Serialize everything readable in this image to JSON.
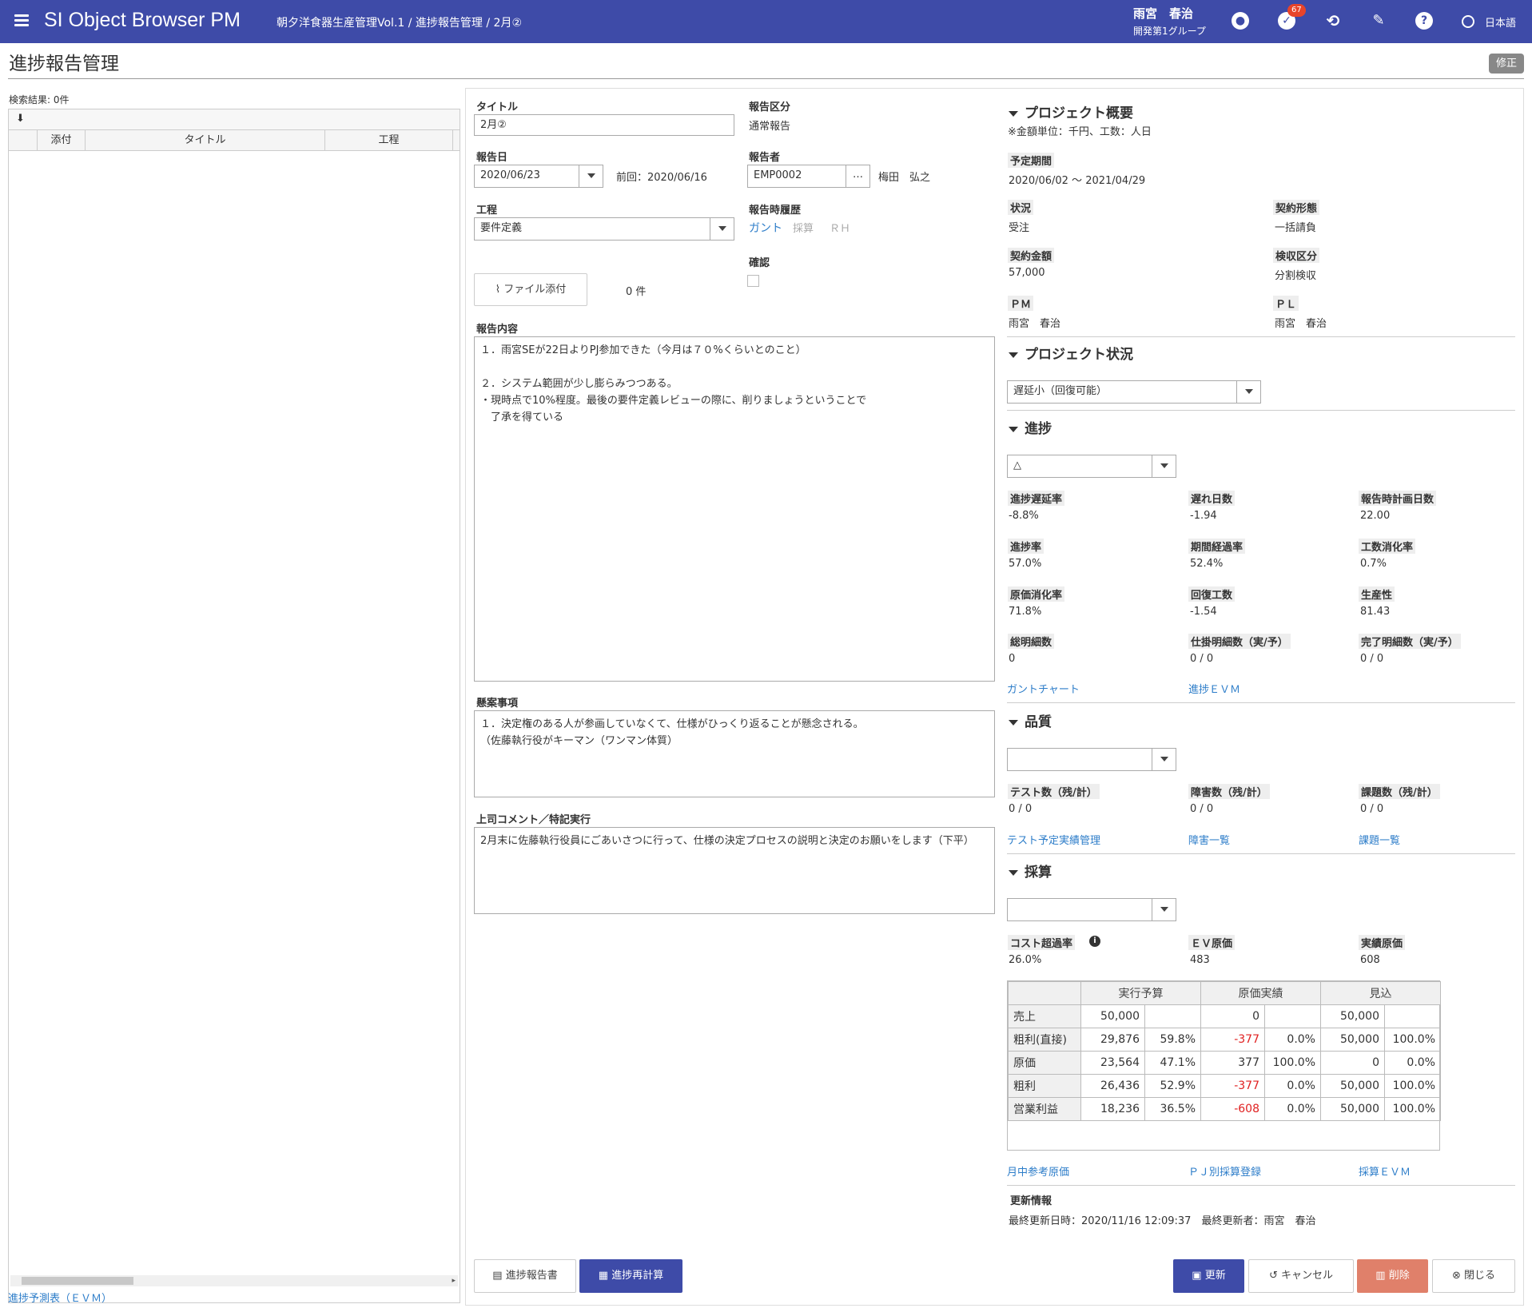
{
  "header": {
    "app_title": "SI Object Browser PM",
    "breadcrumb": "朝夕洋食器生産管理Vol.1 / 進捗報告管理 / 2月②",
    "user_name": "雨宮　春治",
    "user_group": "開発第1グループ",
    "notification_count": "67",
    "language": "日本語"
  },
  "page": {
    "title": "進捗報告管理",
    "edit_label": "修正"
  },
  "left": {
    "search_result": "検索結果: 0件",
    "columns": [
      "添付",
      "タイトル",
      "工程"
    ],
    "footer_link": "進捗予測表（ＥＶＭ）"
  },
  "form": {
    "title_label": "タイトル",
    "title_value": "2月②",
    "report_type_label": "報告区分",
    "report_type_value": "通常報告",
    "report_date_label": "報告日",
    "report_date_value": "2020/06/23",
    "previous": "前回：2020/06/16",
    "reporter_label": "報告者",
    "reporter_code": "EMP0002",
    "reporter_name": "梅田　弘之",
    "process_label": "工程",
    "process_value": "要件定義",
    "history_label": "報告時履歴",
    "history_links": [
      "ガント",
      "採算",
      "ＲＨ"
    ],
    "confirm_label": "確認",
    "attach_button": "ファイル添付",
    "attach_count": "0 件",
    "content_label": "報告内容",
    "content_value": "１．雨宮SEが22日よりPJ参加できた（今月は７０%くらいとのこと）\n\n２．システム範囲が少し膨らみつつある。\n・現時点で10%程度。最後の要件定義レビューの際に、削りましょうということで\n　了承を得ている",
    "concern_label": "懸案事項",
    "concern_value": "１．決定権のある人が参画していなくて、仕様がひっくり返ることが懸念される。\n（佐藤執行役がキーマン（ワンマン体質）",
    "comment_label": "上司コメント／特記実行",
    "comment_value": "2月末に佐藤執行役員にごあいさつに行って、仕様の決定プロセスの説明と決定のお願いをします（下平）"
  },
  "overview": {
    "title": "プロジェクト概要",
    "note": "※金額単位：千円、工数：人日",
    "period_label": "予定期間",
    "period_value": "2020/06/02 〜 2021/04/29",
    "status_label": "状況",
    "status_value": "受注",
    "contract_type_label": "契約形態",
    "contract_type_value": "一括請負",
    "amount_label": "契約金額",
    "amount_value": "57,000",
    "acceptance_label": "検収区分",
    "acceptance_value": "分割検収",
    "pm_label": "ＰＭ",
    "pm_value": "雨宮　春治",
    "pl_label": "ＰＬ",
    "pl_value": "雨宮　春治"
  },
  "project_status": {
    "title": "プロジェクト状況",
    "value": "遅延小（回復可能）"
  },
  "progress": {
    "title": "進捗",
    "select_value": "△",
    "items": [
      {
        "label": "進捗遅延率",
        "value": "-8.8%"
      },
      {
        "label": "遅れ日数",
        "value": "-1.94"
      },
      {
        "label": "報告時計画日数",
        "value": "22.00"
      },
      {
        "label": "進捗率",
        "value": "57.0%"
      },
      {
        "label": "期間経過率",
        "value": "52.4%"
      },
      {
        "label": "工数消化率",
        "value": "0.7%"
      },
      {
        "label": "原価消化率",
        "value": "71.8%"
      },
      {
        "label": "回復工数",
        "value": "-1.54"
      },
      {
        "label": "生産性",
        "value": "81.43"
      },
      {
        "label": "総明細数",
        "value": "0"
      },
      {
        "label": "仕掛明細数（実/予）",
        "value": "0 / 0"
      },
      {
        "label": "完了明細数（実/予）",
        "value": "0 / 0"
      }
    ],
    "links": [
      "ガントチャート",
      "進捗ＥＶＭ"
    ]
  },
  "quality": {
    "title": "品質",
    "select_value": "",
    "items": [
      {
        "label": "テスト数（残/計）",
        "value": "0 / 0"
      },
      {
        "label": "障害数（残/計）",
        "value": "0 / 0"
      },
      {
        "label": "課題数（残/計）",
        "value": "0 / 0"
      }
    ],
    "links": [
      "テスト予定実績管理",
      "障害一覧",
      "課題一覧"
    ]
  },
  "profit": {
    "title": "採算",
    "select_value": "",
    "items": [
      {
        "label": "コスト超過率",
        "value": "26.0%"
      },
      {
        "label": "ＥＶ原価",
        "value": "483"
      },
      {
        "label": "実績原価",
        "value": "608"
      }
    ],
    "table": {
      "headers": [
        "",
        "実行予算",
        "原価実績",
        "見込"
      ],
      "rows": [
        [
          "売上",
          "50,000",
          "",
          "0",
          "",
          "50,000",
          ""
        ],
        [
          "粗利(直接)",
          "29,876",
          "59.8%",
          "-377",
          "0.0%",
          "50,000",
          "100.0%"
        ],
        [
          "原価",
          "23,564",
          "47.1%",
          "377",
          "100.0%",
          "0",
          "0.0%"
        ],
        [
          "粗利",
          "26,436",
          "52.9%",
          "-377",
          "0.0%",
          "50,000",
          "100.0%"
        ],
        [
          "営業利益",
          "18,236",
          "36.5%",
          "-608",
          "0.0%",
          "50,000",
          "100.0%"
        ]
      ]
    },
    "links": [
      "月中参考原価",
      "ＰＪ別採算登録",
      "採算ＥＶＭ"
    ]
  },
  "update_info": {
    "title": "更新情報",
    "value": "最終更新日時：2020/11/16 12:09:37　最終更新者：雨宮　春治"
  },
  "buttons": {
    "report": "進捗報告書",
    "recalc": "進捗再計算",
    "update": "更新",
    "cancel": "キャンセル",
    "delete": "削除",
    "close": "閉じる"
  },
  "colors": {
    "header_bg": "#3e4ba8",
    "link": "#2d7dc9",
    "negative": "#e02020",
    "delete": "#e0806a"
  }
}
